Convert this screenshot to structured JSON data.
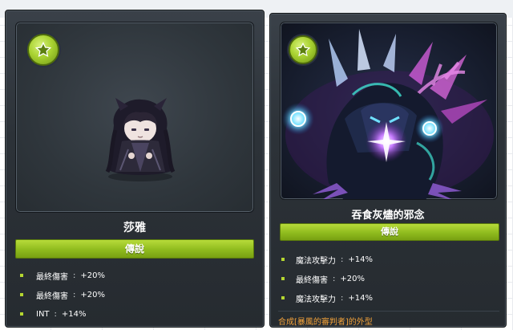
{
  "cards": [
    {
      "name": "莎雅",
      "rarity": "傳說",
      "stats": [
        {
          "name": "最終傷害",
          "sep": ":",
          "value": "+20%"
        },
        {
          "name": "最終傷害",
          "sep": ":",
          "value": "+20%"
        },
        {
          "name": "INT",
          "sep": ":",
          "value": "+14%"
        }
      ],
      "art_icon": "chibi-character-icon",
      "badge_icon": "star-icon"
    },
    {
      "name": "吞食灰燼的邪念",
      "rarity": "傳說",
      "stats": [
        {
          "name": "魔法攻擊力",
          "sep": ":",
          "value": "+14%"
        },
        {
          "name": "最終傷害",
          "sep": ":",
          "value": "+20%"
        },
        {
          "name": "魔法攻擊力",
          "sep": ":",
          "value": "+14%"
        }
      ],
      "note": "合成[暴風的審判者]的外型",
      "art_icon": "dark-creature-icon",
      "badge_icon": "star-icon"
    }
  ],
  "colors": {
    "accent_green": "#9cc72a",
    "card_bg": "#2c3238",
    "note_orange": "#f2a23a",
    "bullet": "#b5d630"
  }
}
